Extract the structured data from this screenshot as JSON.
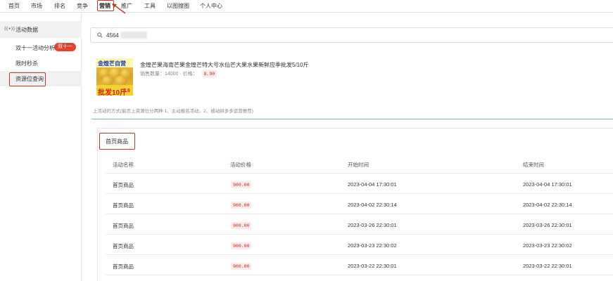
{
  "nav": {
    "items": [
      "首页",
      "市场",
      "排名",
      "竞争",
      "营销",
      "推广",
      "工具",
      "以图搜图",
      "个人中心"
    ],
    "active_index": 4
  },
  "sidebar": {
    "header_icon": "broadcast-icon",
    "header_icon_glyph": "((•))",
    "header_label": "活动数据",
    "items": [
      {
        "label": "双十一活动分析",
        "badge": "双十一"
      },
      {
        "label": "限时秒杀"
      },
      {
        "label": "资源位查询"
      }
    ],
    "selected_index": 2
  },
  "search": {
    "value": "4564"
  },
  "product": {
    "image_top_text": "金煌芒自营",
    "image_bottom_text": "批发10斤",
    "image_bottom_price": "8.9",
    "title": "金煌芒果海南芒果金煌芒特大号水仙芒大果水果新鲜应季批发5/10斤",
    "sales_label": "销售数量：14000",
    "separator": "·",
    "price_label": "价格：",
    "price": "8.90"
  },
  "note": "上活动的方式(能否上资源位分两种 1、主动报名活动，2、被动拼多多运营推荐)",
  "table": {
    "title": "首页商品",
    "headers": [
      "活动名称",
      "活动价格",
      "开始时间",
      "结束时间"
    ],
    "rows": [
      [
        "首页商品",
        "900.00",
        "2023-04-04 17:30:01",
        "2023-04-04 17:30:01"
      ],
      [
        "首页商品",
        "900.00",
        "2023-04-02 22:30:14",
        "2023-04-02 22:30:14"
      ],
      [
        "首页商品",
        "900.00",
        "2023-03-26 22:30:01",
        "2023-03-26 22:30:01"
      ],
      [
        "首页商品",
        "900.00",
        "2023-03-23 22:30:02",
        "2023-03-23 22:30:02"
      ],
      [
        "首页商品",
        "900.00",
        "2023-03-22 22:30:01",
        "2023-03-22 22:30:01"
      ]
    ]
  },
  "colors": {
    "highlight_border": "#c0392b",
    "badge_bg": "#e0432f",
    "price_text": "#c0392b",
    "divider": "#7ab3d6"
  }
}
